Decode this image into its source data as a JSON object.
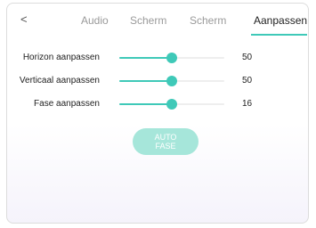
{
  "header": {
    "back_icon": "chevron-left-icon",
    "back_glyph": "<",
    "tabs": [
      {
        "label": "Audio",
        "active": false
      },
      {
        "label": "Scherm",
        "active": false
      },
      {
        "label": "Scherm",
        "active": false
      },
      {
        "label": "Aanpassen",
        "active": true
      }
    ]
  },
  "adjust": {
    "rows": [
      {
        "label": "Horizon aanpassen",
        "value": "50",
        "level": 0.5
      },
      {
        "label": "Verticaal aanpassen",
        "value": "50",
        "level": 0.5
      },
      {
        "label": "Fase aanpassen",
        "value": "16",
        "level": 0.5
      }
    ],
    "auto_line1": "AUTO",
    "auto_line2": "FASE"
  },
  "colors": {
    "accent": "#3fc9b8",
    "button_bg": "#a6e6da"
  }
}
